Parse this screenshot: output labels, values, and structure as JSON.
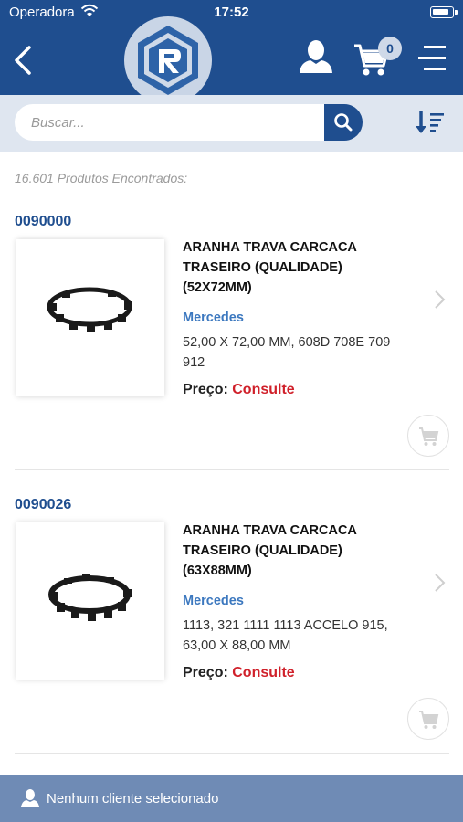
{
  "status_bar": {
    "carrier": "Operadora",
    "time": "17:52"
  },
  "nav": {
    "back_icon": "chevron-left-icon",
    "logo_icon": "brand-logo",
    "user_icon": "user-icon",
    "cart_icon": "cart-icon",
    "cart_count": "0",
    "menu_icon": "hamburger-menu-icon"
  },
  "search": {
    "placeholder": "Buscar...",
    "button_icon": "search-icon",
    "sort_icon": "sort-descending-icon"
  },
  "results": {
    "count_text": "16.601 Produtos Encontrados:"
  },
  "products": [
    {
      "code": "0090000",
      "title": "ARANHA TRAVA CARCACA TRASEIRO (QUALIDADE) (52X72MM)",
      "brand": "Mercedes",
      "description": "52,00 X 72,00 MM, 608D 708E 709 912",
      "price_label": "Preço:",
      "price_value": "Consulte"
    },
    {
      "code": "0090026",
      "title": "ARANHA TRAVA CARCACA TRASEIRO (QUALIDADE) (63X88MM)",
      "brand": "Mercedes",
      "description": "1113, 321 1111 1113 ACCELO 915, 63,00 X 88,00 MM",
      "price_label": "Preço:",
      "price_value": "Consulte"
    }
  ],
  "footer": {
    "client_text": "Nenhum cliente selecionado",
    "icon": "user-icon"
  },
  "colors": {
    "primary": "#1f4e8f",
    "search_bg": "#dfe6f0",
    "brand_link": "#3c78bf",
    "price_red": "#d0202a",
    "footer_bg": "#6f8bb5"
  }
}
